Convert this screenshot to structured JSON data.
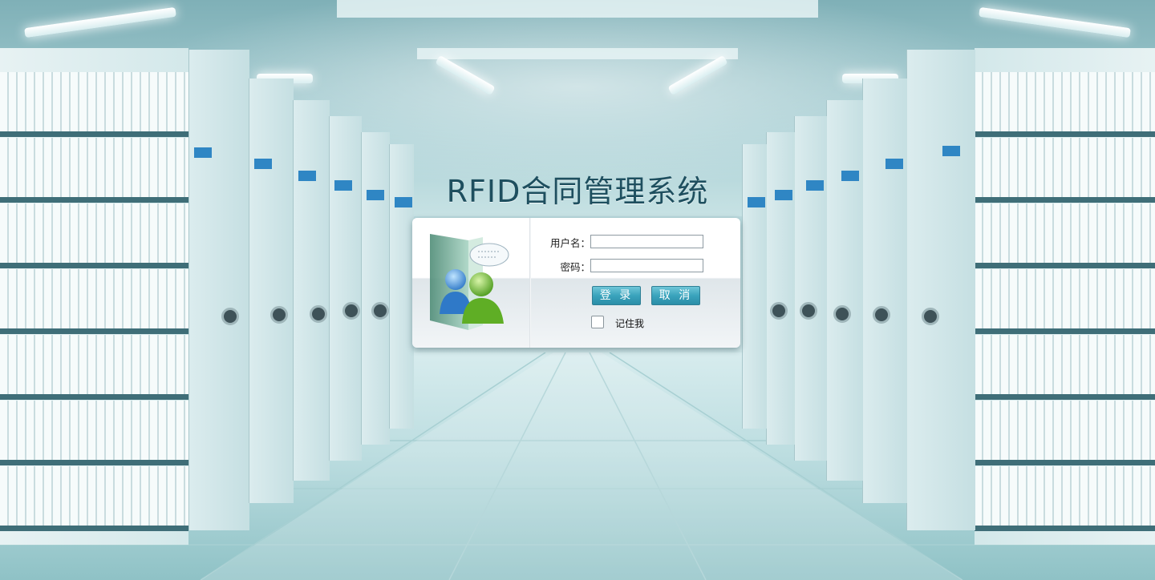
{
  "app": {
    "title": "RFID合同管理系统"
  },
  "login": {
    "username_label": "用户名：",
    "username_value": "",
    "password_label": "密码：",
    "password_value": "",
    "login_button": "登 录",
    "cancel_button": "取 消",
    "remember_label": "记住我",
    "remember_checked": false,
    "illustration_icon": "users-icon"
  },
  "colors": {
    "title_text": "#1e4f5f",
    "button_top": "#6fc6d8",
    "button_bottom": "#2b8ea8",
    "background_teal": "#a9cfd3"
  }
}
